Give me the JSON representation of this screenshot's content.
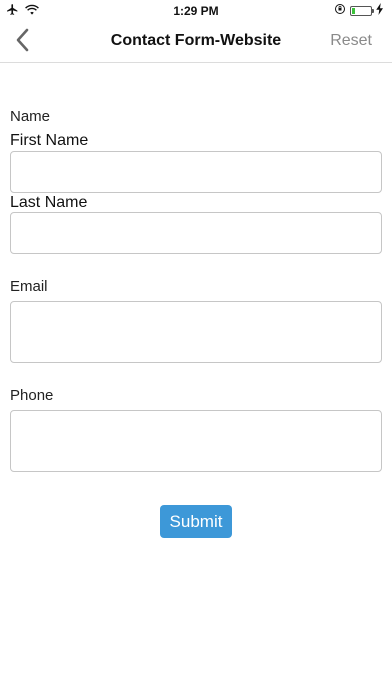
{
  "status_bar": {
    "time": "1:29 PM",
    "left_icons": [
      "airplane-icon",
      "wifi-icon"
    ],
    "right_icons": [
      "orientation-lock-icon",
      "battery-icon",
      "charging-icon"
    ],
    "battery_level": 0.15
  },
  "navbar": {
    "title": "Contact Form-Website",
    "reset_label": "Reset",
    "back_icon": "chevron-left-icon"
  },
  "form": {
    "name_label": "Name",
    "first_name_label": "First Name",
    "first_name_value": "",
    "last_name_label": "Last Name",
    "last_name_value": "",
    "email_label": "Email",
    "email_value": "",
    "phone_label": "Phone",
    "phone_value": "",
    "submit_label": "Submit"
  },
  "colors": {
    "accent": "#3d98d8",
    "reset_text": "#8a8a8a",
    "field_border": "#c6c6c6"
  }
}
